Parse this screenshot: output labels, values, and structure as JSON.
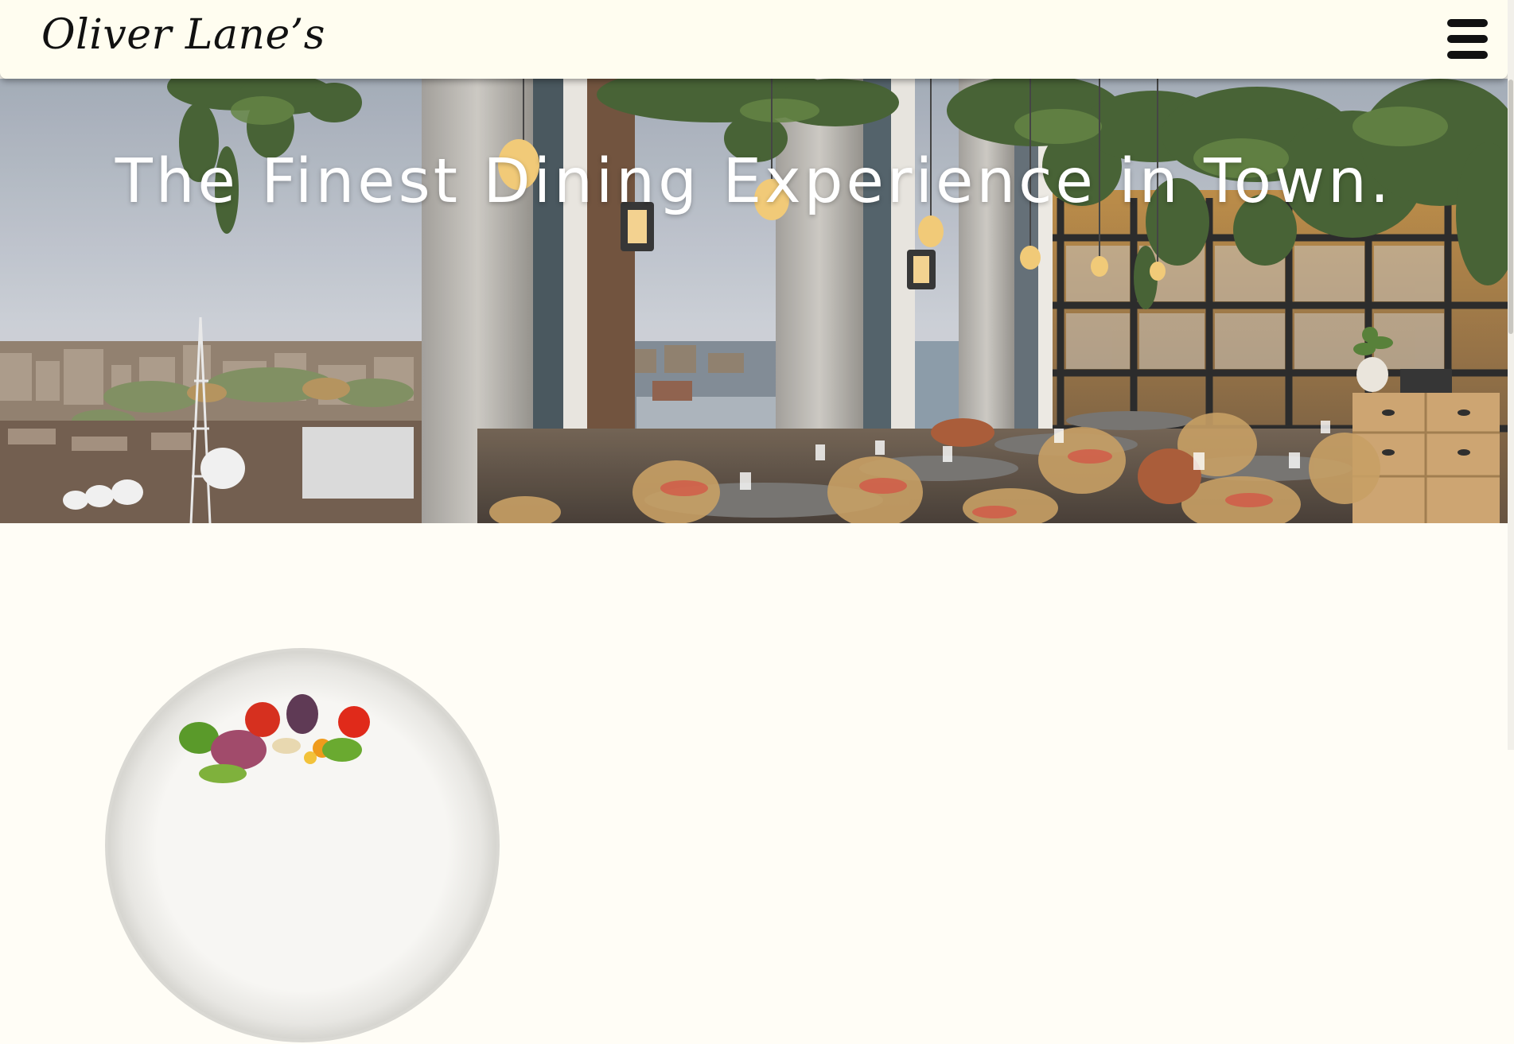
{
  "header": {
    "logo_text": "Oliver Lane’s",
    "menu_icon": "hamburger-menu-icon"
  },
  "hero": {
    "title": "The Finest Dining Experience in Town."
  },
  "colors": {
    "header_bg": "#fffdf0",
    "page_bg": "#fffdf6",
    "hero_text": "#ffffff",
    "logo_text": "#111111"
  }
}
